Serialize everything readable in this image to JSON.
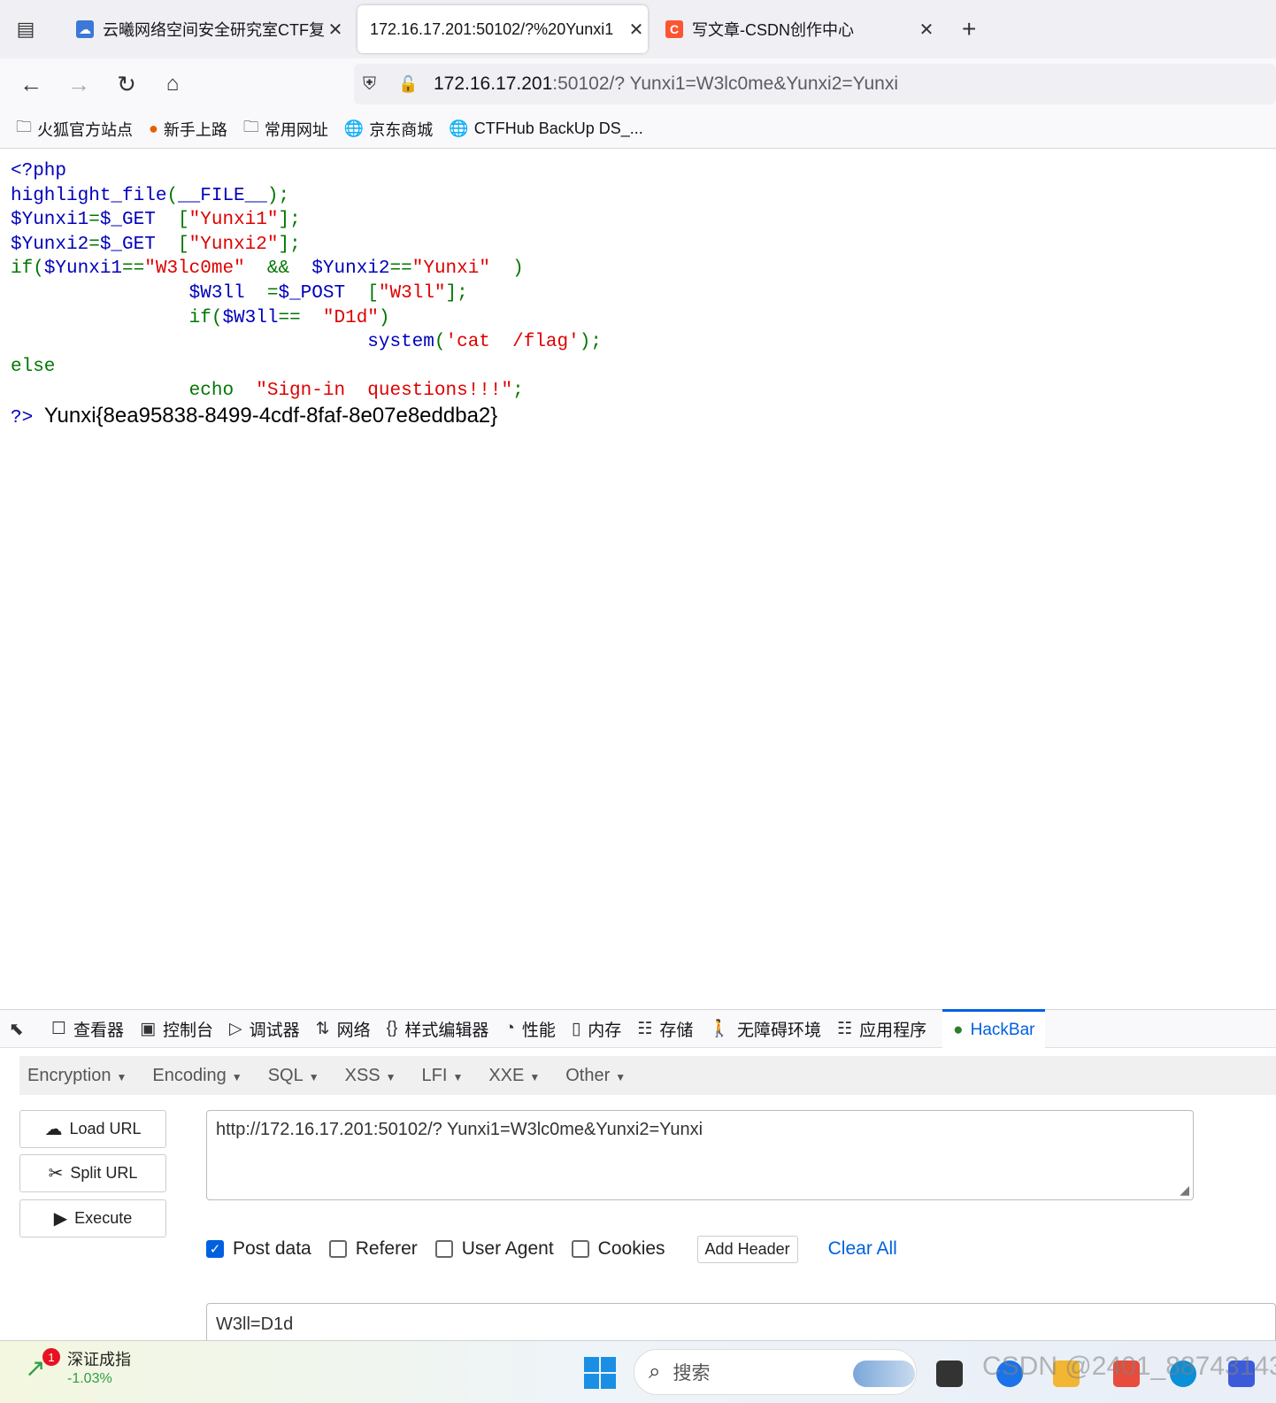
{
  "browser": {
    "tabs": [
      {
        "title": "云曦网络空间安全研究室CTF复",
        "favicon": "cloud-icon",
        "favicon_color": "#3b78d8",
        "active": false
      },
      {
        "title": "172.16.17.201:50102/?%20Yunxi1",
        "favicon": "",
        "active": true
      },
      {
        "title": "写文章-CSDN创作中心",
        "favicon": "C",
        "favicon_color": "#fc5531",
        "active": false
      }
    ],
    "url_host": "172.16.17.201",
    "url_rest": ":50102/? Yunxi1=W3lc0me&Yunxi2=Yunxi",
    "bookmarks": [
      "火狐官方站点",
      "新手上路",
      "常用网址",
      "京东商城",
      "CTFHub BackUp DS_..."
    ]
  },
  "page": {
    "code": {
      "l1": "<?php",
      "l2a": "highlight_file",
      "l2b": "(",
      "l2c": "__FILE__",
      "l2d": ");",
      "l3a": "$Yunxi1",
      "l3b": "=",
      "l3c": "$_GET",
      "l3d": "  [",
      "l3e": "\"Yunxi1\"",
      "l3f": "];",
      "l4a": "$Yunxi2",
      "l4b": "=",
      "l4c": "$_GET",
      "l4d": "  [",
      "l4e": "\"Yunxi2\"",
      "l4f": "];",
      "l5a": "if(",
      "l5b": "$Yunxi1",
      "l5c": "==",
      "l5d": "\"W3lc0me\"",
      "l5e": "  &&  ",
      "l5f": "$Yunxi2",
      "l5g": "==",
      "l5h": "\"Yunxi\"",
      "l5i": "  )",
      "l6a": "                $W3ll",
      "l6b": "  =",
      "l6c": "$_POST",
      "l6d": "  [",
      "l6e": "\"W3ll\"",
      "l6f": "];",
      "l7a": "                if(",
      "l7b": "$W3ll",
      "l7c": "==  ",
      "l7d": "\"D1d\"",
      "l7e": ")",
      "l8a": "                                system",
      "l8b": "(",
      "l8c": "'cat  /flag'",
      "l8d": ");",
      "l9": "else",
      "l10a": "                echo  ",
      "l10b": "\"Sign-in  questions!!!\"",
      "l10c": ";",
      "l11": "?>"
    },
    "flag": "Yunxi{8ea95838-8499-4cdf-8faf-8e07e8eddba2}"
  },
  "devtools": {
    "tabs": [
      "查看器",
      "控制台",
      "调试器",
      "网络",
      "样式编辑器",
      "性能",
      "内存",
      "存储",
      "无障碍环境",
      "应用程序",
      "HackBar"
    ],
    "tab_icons": [
      "inspector-icon",
      "console-icon",
      "debugger-icon",
      "network-icon",
      "style-editor-icon",
      "performance-icon",
      "memory-icon",
      "storage-icon",
      "accessibility-icon",
      "application-icon",
      "hackbar-icon"
    ]
  },
  "hackbar": {
    "menu": [
      "Encryption",
      "Encoding",
      "SQL",
      "XSS",
      "LFI",
      "XXE",
      "Other"
    ],
    "load_url": "Load URL",
    "split_url": "Split URL",
    "execute": "Execute",
    "url_value": "http://172.16.17.201:50102/? Yunxi1=W3lc0me&Yunxi2=Yunxi",
    "options": {
      "post_data": "Post data",
      "referer": "Referer",
      "user_agent": "User Agent",
      "cookies": "Cookies"
    },
    "post_checked": true,
    "add_header": "Add Header",
    "clear_all": "Clear All",
    "post_value": "W3ll=D1d"
  },
  "taskbar": {
    "stock_badge": "1",
    "stock_name": "深证成指",
    "stock_change": "-1.03%",
    "search_placeholder": "搜索",
    "watermark": "CSDN @2401_88743143"
  }
}
